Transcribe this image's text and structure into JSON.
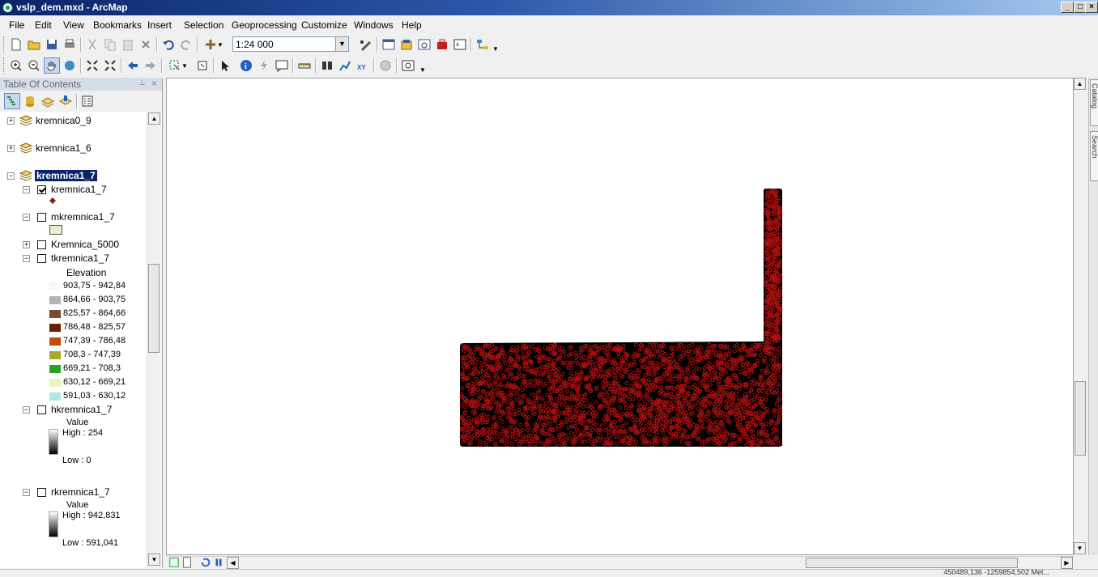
{
  "window": {
    "title": "vslp_dem.mxd - ArcMap",
    "controls": [
      "_",
      "□",
      "×"
    ]
  },
  "menubar": [
    "File",
    "Edit",
    "View",
    "Bookmarks",
    "Insert",
    "Selection",
    "Geoprocessing",
    "Customize",
    "Windows",
    "Help"
  ],
  "standard_toolbar": {
    "scale_value": "1:24 000",
    "icons": [
      "new-icon",
      "open-icon",
      "save-icon",
      "print-icon",
      "cut-icon",
      "copy-icon",
      "paste-icon",
      "delete-icon",
      "undo-icon",
      "redo-icon",
      "add-data-icon",
      "editor-icon",
      "toc-window-icon",
      "catalog-icon",
      "search-window-icon",
      "arctoolbox-icon",
      "python-icon",
      "model-builder-icon"
    ]
  },
  "tools_toolbar": {
    "icons": [
      "zoom-in-icon",
      "zoom-out-icon",
      "pan-icon",
      "full-extent-icon",
      "fixed-zoom-in-icon",
      "fixed-zoom-out-icon",
      "back-icon",
      "forward-icon",
      "select-features-icon",
      "clear-selection-icon",
      "select-elements-icon",
      "identify-icon",
      "hyperlink-icon",
      "html-popup-icon",
      "measure-icon",
      "find-icon",
      "find-route-icon",
      "go-to-xy-icon",
      "time-slider-icon",
      "viewer-window-icon"
    ]
  },
  "toc": {
    "title": "Table Of Contents",
    "pin": "⊥",
    "close": "×",
    "layers": [
      {
        "name": "kremnica0_9",
        "type": "group",
        "expanded": false
      },
      {
        "name": "kremnica1_6",
        "type": "group",
        "expanded": false
      },
      {
        "name": "kremnica1_7",
        "type": "group",
        "expanded": true,
        "selected": true
      }
    ],
    "sublayers": {
      "points": {
        "name": "kremnica1_7",
        "checked": true
      },
      "polygon": {
        "name": "mkremnica1_7",
        "checked": false
      },
      "kremnica5000": {
        "name": "Kremnica_5000",
        "checked": false
      },
      "tin": {
        "name": "tkremnica1_7",
        "checked": false,
        "legend_title": "Elevation"
      },
      "hillshade": {
        "name": "hkremnica1_7",
        "checked": false,
        "legend_title": "Value",
        "high": "High : 254",
        "low": "Low : 0"
      },
      "raster": {
        "name": "rkremnica1_7",
        "checked": false,
        "legend_title": "Value",
        "high": "High : 942,831",
        "low": "Low : 591,041"
      }
    },
    "elevation_classes": [
      {
        "label": "903,75 - 942,84",
        "color": "#f7f7f7"
      },
      {
        "label": "864,66 - 903,75",
        "color": "#b3b3b3"
      },
      {
        "label": "825,57 - 864,66",
        "color": "#7a4a2e"
      },
      {
        "label": "786,48 - 825,57",
        "color": "#6b1e08"
      },
      {
        "label": "747,39 - 786,48",
        "color": "#c44a0a"
      },
      {
        "label": "708,3 - 747,39",
        "color": "#a8a82a"
      },
      {
        "label": "669,21 - 708,3",
        "color": "#2aa02a"
      },
      {
        "label": "630,12 - 669,21",
        "color": "#e8f5b8"
      },
      {
        "label": "591,03 - 630,12",
        "color": "#aaeae4"
      }
    ],
    "point_color": "#8b1a1a",
    "polygon_fill": "#e8f0c8"
  },
  "map": {
    "point_color": "#b01010",
    "background_fill": "#000000"
  },
  "dock_tabs": [
    "Catalog",
    "Search"
  ],
  "statusbar": {
    "coords": "450489,136  -1259854,502 Met..."
  }
}
